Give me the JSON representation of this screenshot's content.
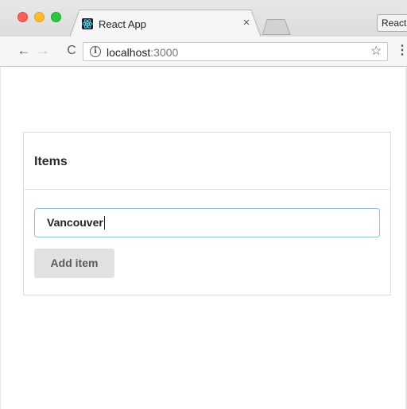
{
  "browser": {
    "tab": {
      "title": "React App",
      "close": "×"
    },
    "profile_label": "React",
    "address": {
      "host": "localhost",
      "port": ":3000"
    },
    "nav": {
      "back": "←",
      "forward": "→",
      "reload": "C"
    },
    "icons": {
      "info": "i",
      "star": "☆",
      "menu": "⋮"
    },
    "colors": {
      "close": "#fc5f57",
      "minimize": "#fdbc2e",
      "zoom": "#28c840"
    }
  },
  "page": {
    "card": {
      "title": "Items",
      "input": {
        "value": "Vancouver"
      },
      "add_button_label": "Add item"
    },
    "colors": {
      "input_border": "#8fc3d4",
      "button_bg": "#e0e1e2"
    }
  }
}
